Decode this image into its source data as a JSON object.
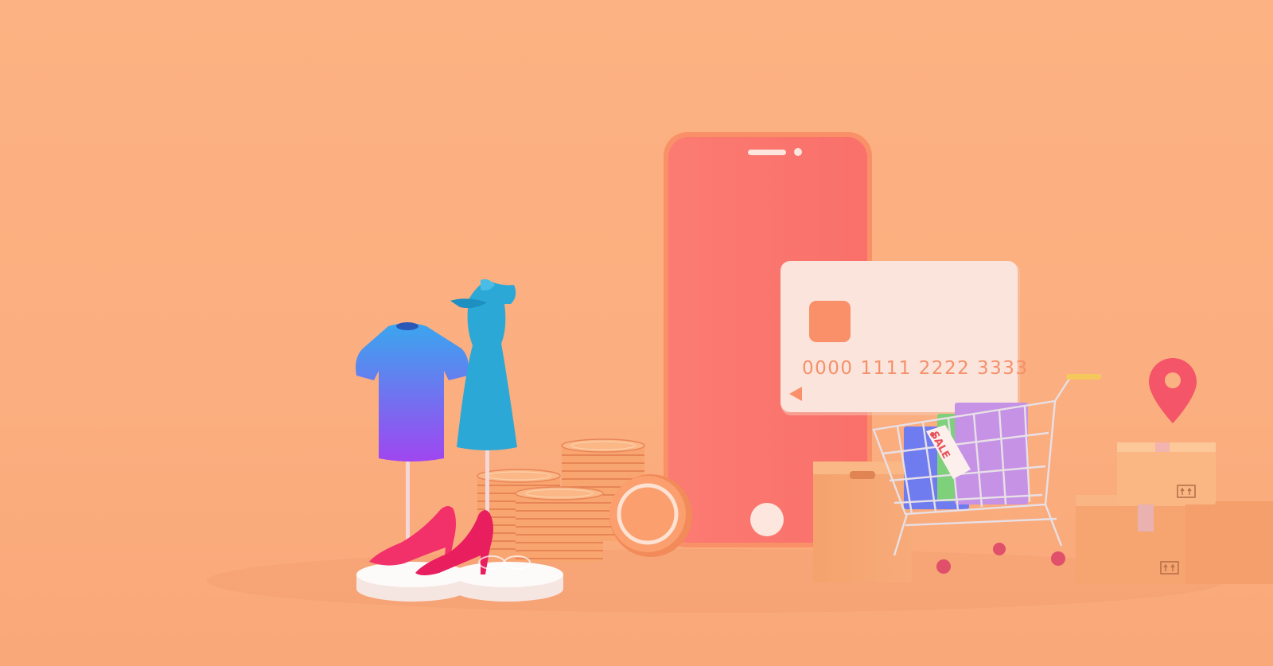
{
  "scene": {
    "background_color": "#fcb081",
    "phone_color": "#fb7870",
    "card": {
      "number": "0000 1111 2222 3333",
      "chip_color": "#f9906a",
      "card_color": "#fbe1d8"
    },
    "sale_tag": {
      "label": "SALE"
    },
    "icons": [
      "smartphone-icon",
      "credit-card-icon",
      "shopping-cart-icon",
      "location-pin-icon",
      "coin-stack-icon",
      "cardboard-box-icon",
      "tshirt-icon",
      "dress-icon",
      "high-heel-shoe-icon"
    ]
  }
}
